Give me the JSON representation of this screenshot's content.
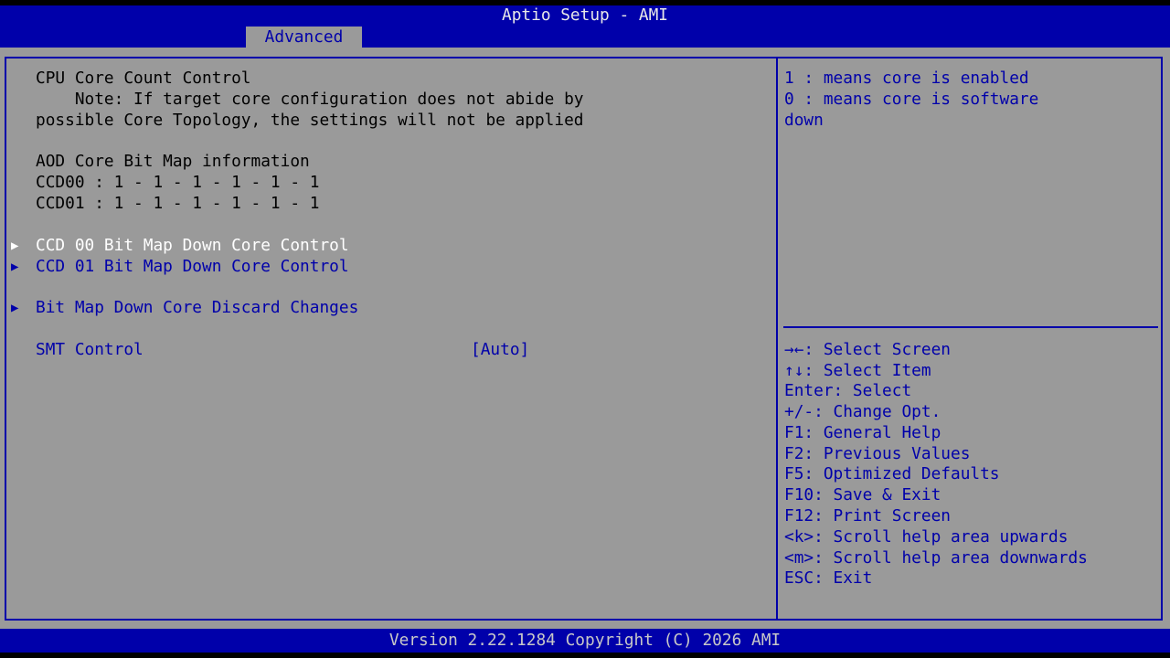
{
  "header": {
    "title": "Aptio Setup - AMI",
    "active_tab": "Advanced"
  },
  "main": {
    "section_title": "CPU Core Count Control",
    "note_line1": "    Note: If target core configuration does not abide by",
    "note_line2": "possible Core Topology, the settings will not be applied",
    "aod_title": "AOD Core Bit Map information",
    "ccd00_info": "CCD00 : 1 - 1 - 1 - 1 - 1 - 1",
    "ccd01_info": "CCD01 : 1 - 1 - 1 - 1 - 1 - 1",
    "submenus": [
      {
        "label": "CCD 00 Bit Map Down Core Control",
        "selected": true
      },
      {
        "label": "CCD 01 Bit Map Down Core Control",
        "selected": false
      },
      {
        "label": "Bit Map Down Core Discard Changes",
        "selected": false
      }
    ],
    "smt_control": {
      "label": "SMT Control",
      "value": "[Auto]"
    },
    "submenu_arrow": "▶"
  },
  "help": {
    "lines": [
      "1 : means core is enabled",
      "0 : means core is software",
      "down"
    ]
  },
  "keys": [
    "→←: Select Screen",
    "↑↓: Select Item",
    "Enter: Select",
    "+/-: Change Opt.",
    "F1: General Help",
    "F2: Previous Values",
    "F5: Optimized Defaults",
    "F10: Save & Exit",
    "F12: Print Screen",
    "<k>: Scroll help area upwards",
    "<m>: Scroll help area downwards",
    "ESC: Exit"
  ],
  "footer": {
    "version": "Version 2.22.1284 Copyright (C) 2026 AMI"
  },
  "colors": {
    "header_bg": "#0000aa",
    "panel_bg": "#9a9a9a",
    "selected_text": "#ffffff",
    "item_text": "#0000aa",
    "static_text": "#000000"
  }
}
